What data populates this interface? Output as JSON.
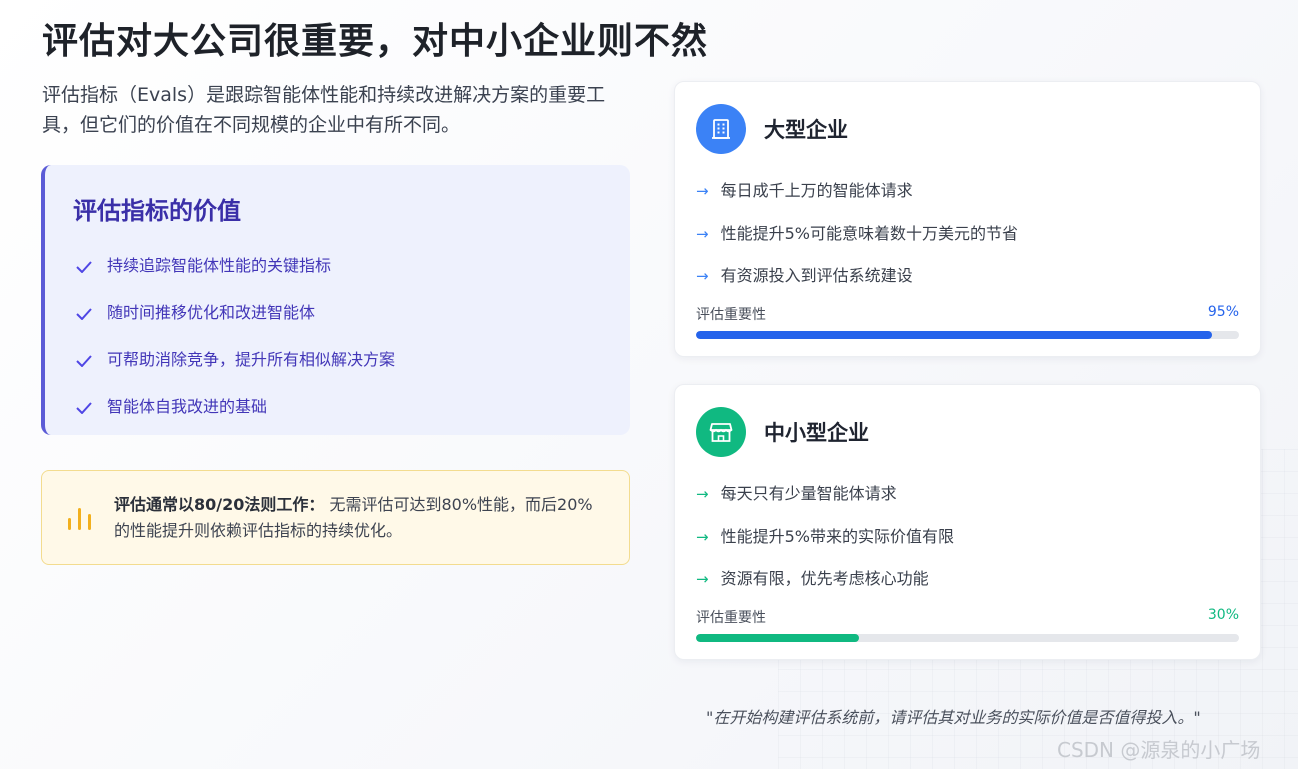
{
  "page": {
    "title": "评估对大公司很重要，对中小企业则不然",
    "intro": "评估指标（Evals）是跟踪智能体性能和持续改进解决方案的重要工具，但它们的价值在不同规模的企业中有所不同。"
  },
  "value_box": {
    "heading": "评估指标的价值",
    "items": [
      {
        "label": "持续追踪智能体性能的关键指标",
        "icon": "check-icon"
      },
      {
        "label": "随时间推移优化和改进智能体",
        "icon": "check-icon"
      },
      {
        "label": "可帮助消除竞争，提升所有相似解决方案",
        "icon": "check-icon"
      },
      {
        "label": "智能体自我改进的基础",
        "icon": "check-icon"
      }
    ]
  },
  "note": {
    "icon": "bar-chart-icon",
    "bold": "评估通常以80/20法则工作：",
    "text": "无需评估可达到80%性能，而后20%的性能提升则依赖评估指标的持续优化。"
  },
  "cards": [
    {
      "title": "大型企业",
      "icon": "building-icon",
      "color": "#3b82f6",
      "items": [
        "每日成千上万的智能体请求",
        "性能提升5%可能意味着数十万美元的节省",
        "有资源投入到评估系统建设"
      ],
      "meter_label": "评估重要性",
      "meter_value_text": "95%",
      "meter_value": 0.95
    },
    {
      "title": "中小型企业",
      "icon": "store-icon",
      "color": "#10b981",
      "items": [
        "每天只有少量智能体请求",
        "性能提升5%带来的实际价值有限",
        "资源有限，优先考虑核心功能"
      ],
      "meter_label": "评估重要性",
      "meter_value_text": "30%",
      "meter_value": 0.3
    }
  ],
  "quote": "\"在开始构建评估系统前，请评估其对业务的实际价值是否值得投入。\"",
  "watermark": "CSDN @源泉的小广场"
}
